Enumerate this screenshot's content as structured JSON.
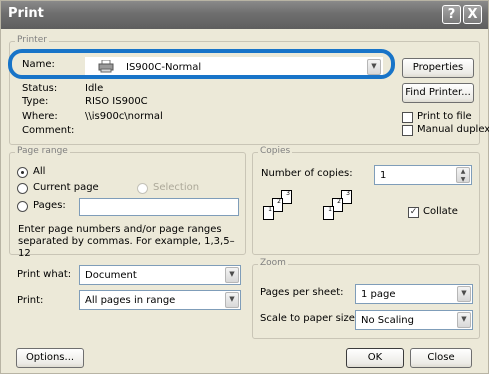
{
  "titlebar": {
    "title": "Print",
    "help_label": "?",
    "close_label": "X"
  },
  "printer": {
    "legend": "Printer",
    "name_label": "Name:",
    "name_value": "IS900C-Normal",
    "status_label": "Status:",
    "status_value": "Idle",
    "type_label": "Type:",
    "type_value": "RISO IS900C",
    "where_label": "Where:",
    "where_value": "\\\\is900c\\normal",
    "comment_label": "Comment:",
    "properties_label": "Properties",
    "find_printer_label": "Find Printer...",
    "print_to_file_label": "Print to file",
    "manual_duplex_label": "Manual duplex"
  },
  "page_range": {
    "legend": "Page range",
    "all_label": "All",
    "current_page_label": "Current page",
    "selection_label": "Selection",
    "pages_label": "Pages:",
    "pages_value": "",
    "hint": "Enter page numbers and/or page ranges separated by commas.  For example, 1,3,5–12"
  },
  "copies": {
    "legend": "Copies",
    "number_label": "Number of copies:",
    "number_value": "1",
    "collate_label": "Collate",
    "collate_checked": true
  },
  "print_what": {
    "label": "Print what:",
    "value": "Document"
  },
  "print": {
    "label": "Print:",
    "value": "All pages in range"
  },
  "zoom": {
    "legend": "Zoom",
    "pages_per_sheet_label": "Pages per sheet:",
    "pages_per_sheet_value": "1 page",
    "scale_label": "Scale to paper size:",
    "scale_value": "No Scaling"
  },
  "footer": {
    "options_label": "Options...",
    "ok_label": "OK",
    "close_label": "Close"
  },
  "colors": {
    "highlight": "#1874c8",
    "dialog_bg": "#ece9d8",
    "titlebar": "#6e6e6e"
  }
}
